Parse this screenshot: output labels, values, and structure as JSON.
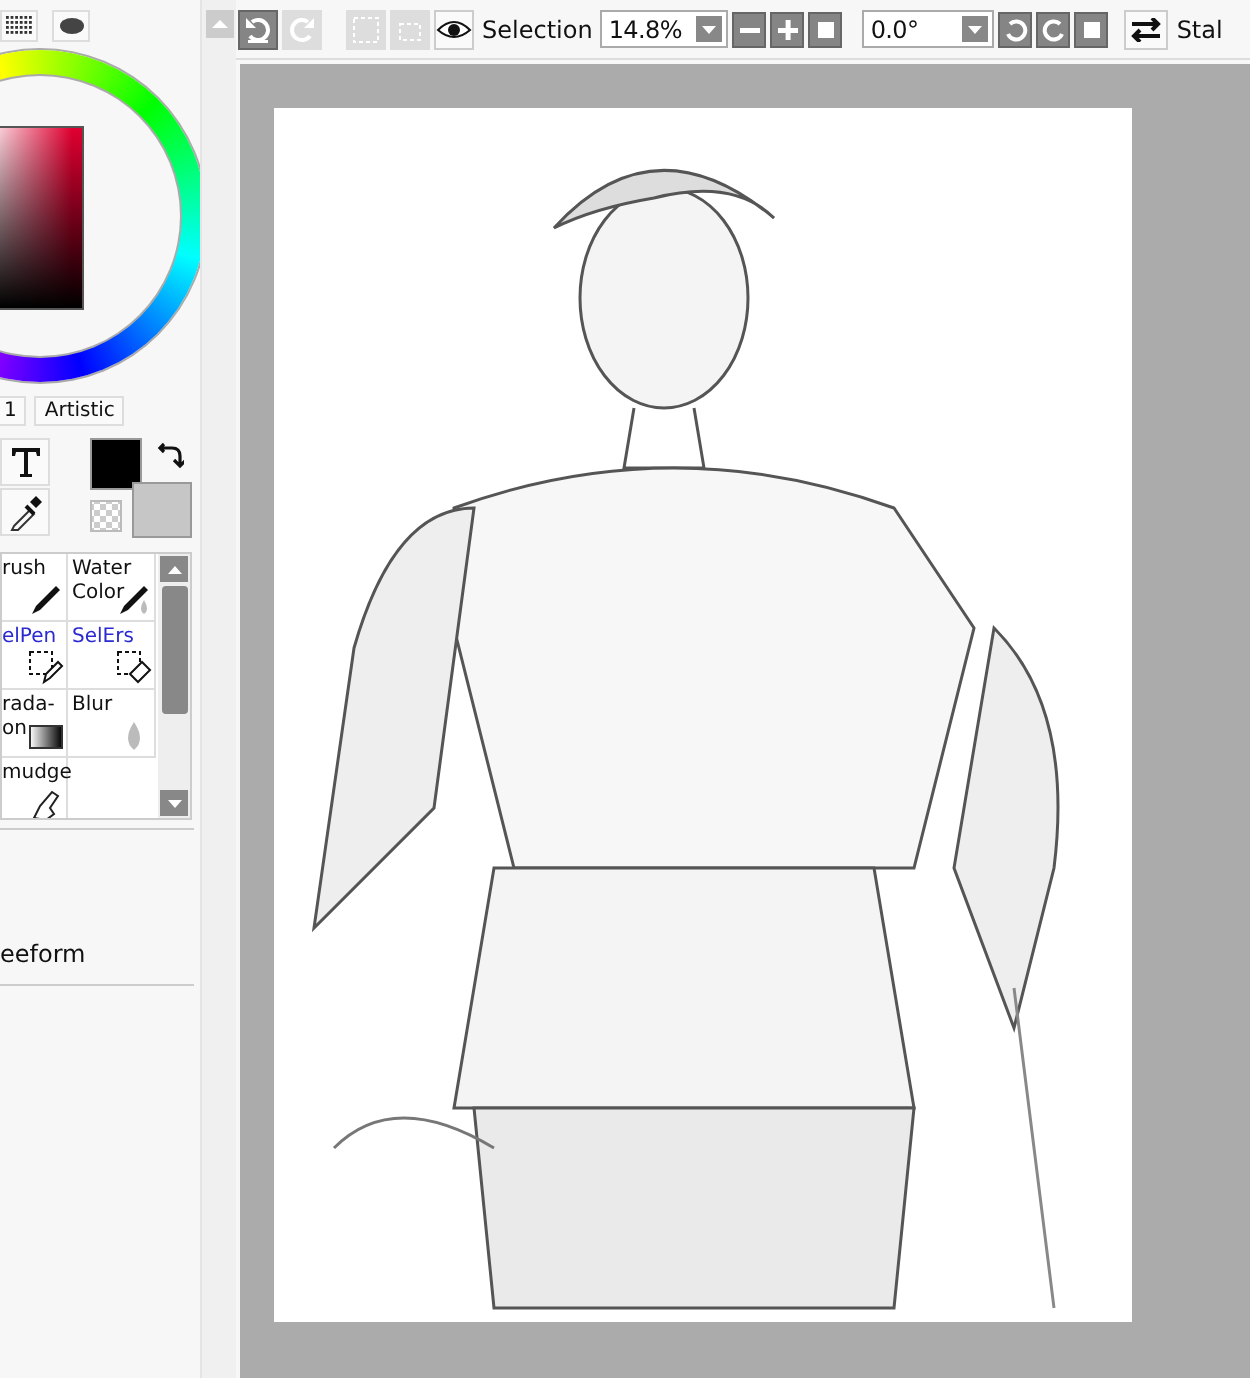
{
  "toolbar": {
    "selection_label": "Selection",
    "zoom": "14.8%",
    "rotation": "0.0°",
    "stabilizer_label": "Stal"
  },
  "color_tabs": [
    "1",
    "Artistic"
  ],
  "tools": [
    {
      "label": "rush",
      "kind": "brush"
    },
    {
      "label": "Water\nColor",
      "kind": "watercolor"
    },
    {
      "label": "elPen",
      "kind": "selpen"
    },
    {
      "label": "SelErs",
      "kind": "selers"
    },
    {
      "label": "rada-\non",
      "kind": "gradation"
    },
    {
      "label": "Blur",
      "kind": "blur"
    },
    {
      "label": "mudge",
      "kind": "smudge"
    }
  ],
  "shape_tool": "eeform"
}
